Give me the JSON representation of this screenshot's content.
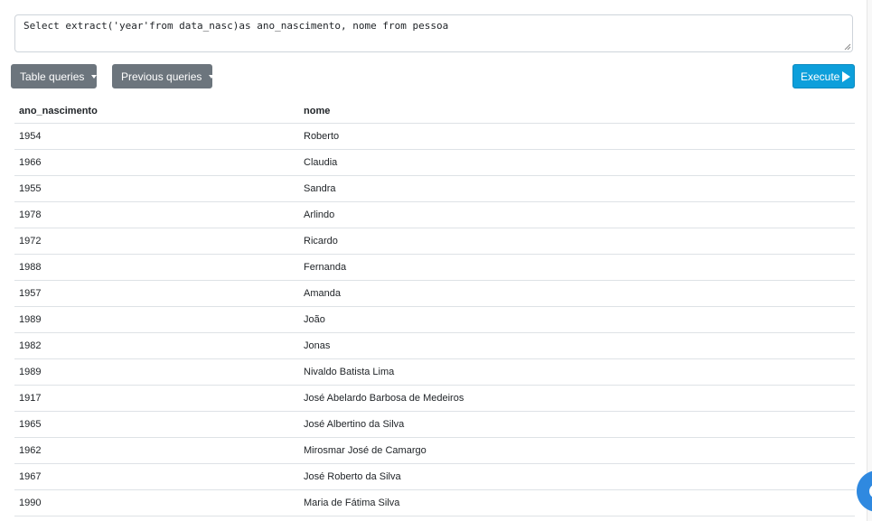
{
  "query": {
    "value": "Select extract('year'from data_nasc)as ano_nascimento, nome from pessoa"
  },
  "toolbar": {
    "table_queries_label": "Table queries",
    "previous_queries_label": "Previous queries",
    "execute_label": "Execute",
    "execute_color": "#0d9fdb",
    "secondary_color": "#6c757d"
  },
  "results": {
    "columns": [
      "ano_nascimento",
      "nome"
    ],
    "rows": [
      [
        "1954",
        "Roberto"
      ],
      [
        "1966",
        "Claudia"
      ],
      [
        "1955",
        "Sandra"
      ],
      [
        "1978",
        "Arlindo"
      ],
      [
        "1972",
        "Ricardo"
      ],
      [
        "1988",
        "Fernanda"
      ],
      [
        "1957",
        "Amanda"
      ],
      [
        "1989",
        "João"
      ],
      [
        "1982",
        "Jonas"
      ],
      [
        "1989",
        "Nivaldo Batista Lima"
      ],
      [
        "1917",
        "José Abelardo Barbosa de Medeiros"
      ],
      [
        "1965",
        "José Albertino da Silva"
      ],
      [
        "1962",
        "Mirosmar José de Camargo"
      ],
      [
        "1967",
        "José Roberto da Silva"
      ],
      [
        "1990",
        "Maria de Fátima Silva"
      ]
    ]
  },
  "icons": {
    "dropdown": "caret-down-icon",
    "execute": "play-icon",
    "help": "chat-bubble-icon"
  }
}
